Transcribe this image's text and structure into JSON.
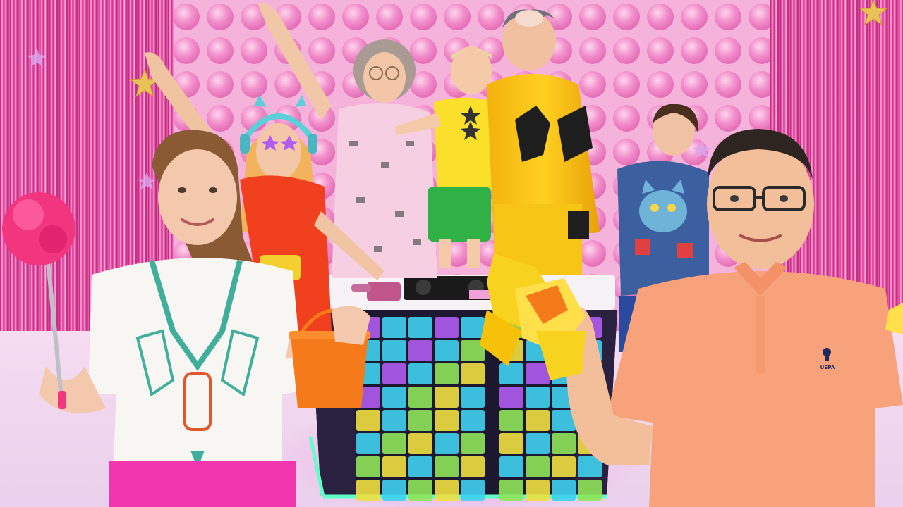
{
  "scene": {
    "kind": "photo",
    "colors": {
      "wall": "#f2a9d6",
      "bubble": "#f07fc4",
      "tinsel": "#e0389a",
      "floor": "#f3d6ee",
      "dj_booth": "#1c1830",
      "pad_cyan": "#3fd2f0",
      "pad_purple": "#b05cf0",
      "pad_green": "#8fe45a",
      "pad_yellow": "#f0e040",
      "woman_shirt": "#f7f5f2",
      "man_shirt": "#f7a27a",
      "bucket": "#f47a1a",
      "duster": "#f2357f",
      "paper": "#f7d21e"
    },
    "icons": [
      "star-decoration-icon",
      "polo-logo-icon"
    ]
  },
  "logo_text": "USPA"
}
